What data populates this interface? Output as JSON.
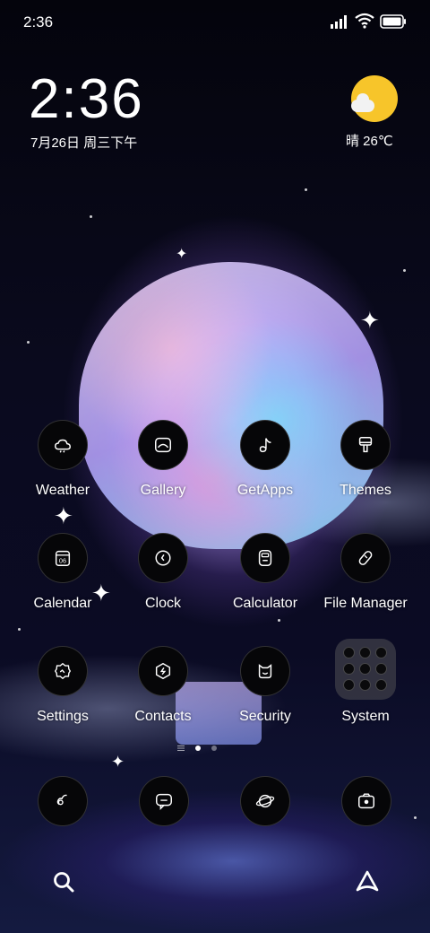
{
  "status_bar": {
    "time": "2:36",
    "icons": [
      "signal-icon",
      "wifi-icon",
      "battery-icon"
    ]
  },
  "clock_widget": {
    "time": "2:36",
    "date": "7月26日 周三下午"
  },
  "weather_widget": {
    "icon": "sunny-partly-cloudy-icon",
    "text": "晴 26℃"
  },
  "apps": [
    {
      "label": "Weather",
      "icon": "weather-icon"
    },
    {
      "label": "Gallery",
      "icon": "gallery-icon"
    },
    {
      "label": "GetApps",
      "icon": "getapps-icon"
    },
    {
      "label": "Themes",
      "icon": "themes-icon"
    },
    {
      "label": "Calendar",
      "icon": "calendar-icon",
      "icon_text": "06"
    },
    {
      "label": "Clock",
      "icon": "clock-icon"
    },
    {
      "label": "Calculator",
      "icon": "calculator-icon"
    },
    {
      "label": "File Manager",
      "icon": "file-manager-icon"
    },
    {
      "label": "Settings",
      "icon": "settings-icon"
    },
    {
      "label": "Contacts",
      "icon": "contacts-icon"
    },
    {
      "label": "Security",
      "icon": "security-icon"
    },
    {
      "label": "System",
      "icon": "folder-icon"
    }
  ],
  "page_indicator": {
    "pages": 2,
    "current": 1
  },
  "dock": [
    {
      "icon": "phone-icon"
    },
    {
      "icon": "messages-icon"
    },
    {
      "icon": "browser-icon"
    },
    {
      "icon": "camera-icon"
    }
  ],
  "bottom_bar": {
    "icons": [
      "search-icon",
      "launcher-icon"
    ]
  },
  "colors": {
    "icon_background": "#060608",
    "sun": "#f7c52a",
    "text": "#ffffff"
  }
}
